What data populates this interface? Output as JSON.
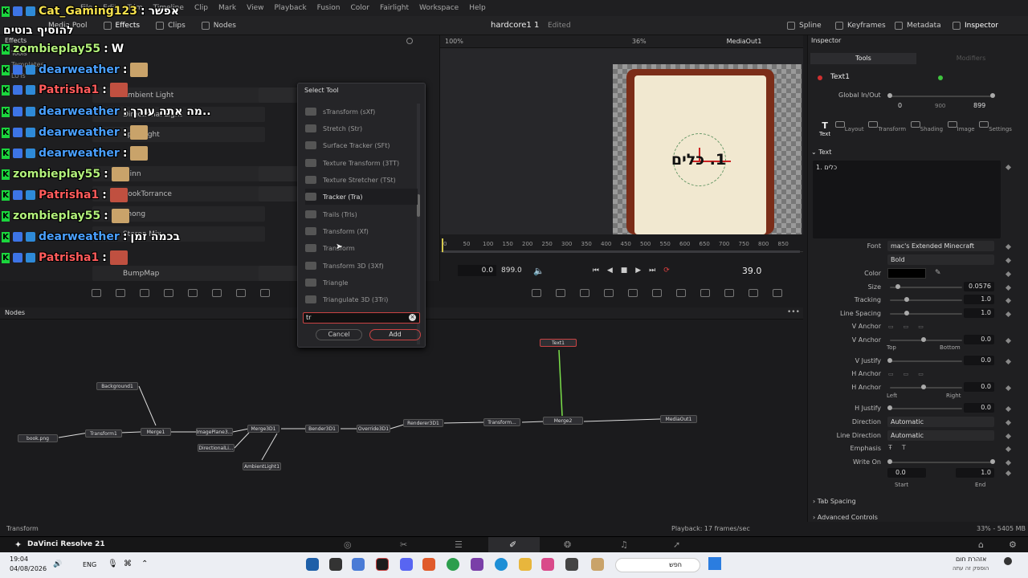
{
  "menu": [
    "Effects",
    "File",
    "Edit",
    "Trim",
    "Timeline",
    "Clip",
    "Mark",
    "View",
    "Playback",
    "Fusion",
    "Color",
    "Fairlight",
    "Workspace",
    "Help"
  ],
  "toolbar": {
    "media_pool": "Media Pool",
    "effects": "Effects",
    "clips": "Clips",
    "nodes": "Nodes",
    "project_title": "hardcore1 1",
    "edited": "Edited",
    "spline": "Spline",
    "keyframes": "Keyframes",
    "metadata": "Metadata",
    "inspector": "Inspector"
  },
  "effects_panel": {
    "header": "Effects",
    "tabs": [
      "Tools",
      "Templates",
      "LUTs"
    ],
    "items": [
      "Ambient Light",
      "Directional Light",
      "Spot Light",
      "Blinn",
      "CookTorrance",
      "Phong",
      "Stereo Mix",
      "BumpMap"
    ],
    "search_icon": "search-icon"
  },
  "viewer": {
    "zoom_left": "100%",
    "zoom_right": "36%",
    "output": "MediaOut1",
    "card_text": "1. כלים",
    "ruler_ticks": [
      "0",
      "50",
      "100",
      "150",
      "200",
      "250",
      "300",
      "350",
      "400",
      "450",
      "500",
      "550",
      "600",
      "650",
      "700",
      "750",
      "800",
      "850"
    ],
    "time_start": "0.0",
    "time_end": "899.0",
    "current_frame": "39.0"
  },
  "dialog": {
    "title": "Select Tool",
    "items": [
      "sTransform (sXf)",
      "Stretch (Str)",
      "Surface Tracker (SFt)",
      "Texture Transform (3TT)",
      "Texture Stretcher (TSt)",
      "Tracker (Tra)",
      "Trails (Trls)",
      "Transform (Xf)",
      "Transform",
      "Transform 3D (3Xf)",
      "Triangle",
      "Triangulate 3D (3Tri)"
    ],
    "selected_index": 5,
    "search_value": "tr",
    "cancel": "Cancel",
    "add": "Add"
  },
  "inspector": {
    "title": "Inspector",
    "tabs": [
      "Tools",
      "Modifiers"
    ],
    "node_name": "Text1",
    "global_label": "Global In/Out",
    "global_in": "0",
    "global_mid": "900",
    "global_out": "899",
    "subtabs": [
      "Text",
      "Layout",
      "Transform",
      "Shading",
      "Image",
      "Settings"
    ],
    "section": "Text",
    "text_value": "1. כלים",
    "font_label": "Font",
    "font_value": "mac's Extended Minecraft",
    "font_style": "Bold",
    "color_label": "Color",
    "color_value": "#000000",
    "size_label": "Size",
    "size_value": "0.0576",
    "tracking_label": "Tracking",
    "tracking_value": "1.0",
    "line_spacing_label": "Line Spacing",
    "line_spacing_value": "1.0",
    "v_anchor_label": "V Anchor",
    "v_anchor2_label": "V Anchor",
    "v_anchor_value": "0.0",
    "top": "Top",
    "bottom": "Bottom",
    "v_justify_label": "V Justify",
    "v_justify_value": "0.0",
    "h_anchor_label": "H Anchor",
    "h_anchor2_label": "H Anchor",
    "h_anchor_value": "0.0",
    "left": "Left",
    "right": "Right",
    "h_justify_label": "H Justify",
    "h_justify_value": "0.0",
    "direction_label": "Direction",
    "direction_value": "Automatic",
    "line_direction_label": "Line Direction",
    "line_direction_value": "Automatic",
    "emphasis_label": "Emphasis",
    "write_on_label": "Write On",
    "write_on_start": "0.0",
    "write_on_end": "1.0",
    "start": "Start",
    "end": "End",
    "tab_spacing": "Tab Spacing",
    "advanced": "Advanced Controls"
  },
  "nodes": {
    "header": "Nodes",
    "list": [
      "Text1",
      "Background1",
      "book.png",
      "Transform1",
      "Merge1",
      "ImagePlane3...",
      "DirectionalLi...",
      "Merge3D1",
      "AmbientLight1",
      "Bender3D1",
      "Override3D1",
      "Renderer3D1",
      "Transform...",
      "Merge2",
      "MediaOut1"
    ]
  },
  "status": {
    "left": "Transform",
    "playback": "Playback: 17 frames/sec",
    "memory": "33% - 5405 MB"
  },
  "resolve": {
    "app": "DaVinci Resolve 21"
  },
  "taskbar": {
    "time": "19:04",
    "date": "04/08/2026",
    "lang": "ENG",
    "search": "חפש",
    "notif_title": "אזהרת חום",
    "notif_body": "הוספק זה עתה"
  },
  "chat": [
    {
      "user": "Cat_Gaming123",
      "msg": "אפשר",
      "color": "#f4e04d",
      "has_thumb": false
    },
    {
      "user": "",
      "msg": "להוסיף בוטים",
      "color": "#fff",
      "has_thumb": false
    },
    {
      "user": "zombieplay55",
      "msg": "W",
      "color": "#b2f07a",
      "has_thumb": false
    },
    {
      "user": "dearweather",
      "msg": "",
      "color": "#4aa0ff",
      "has_thumb": true
    },
    {
      "user": "Patrisha1",
      "msg": "",
      "color": "#ff5b5b",
      "has_thumb": true
    },
    {
      "user": "dearweather",
      "msg": "מה אתה עורך..",
      "color": "#4aa0ff",
      "has_thumb": false
    },
    {
      "user": "dearweather",
      "msg": "",
      "color": "#4aa0ff",
      "has_thumb": true
    },
    {
      "user": "dearweather",
      "msg": "",
      "color": "#4aa0ff",
      "has_thumb": true
    },
    {
      "user": "zombieplay55",
      "msg": "",
      "color": "#b2f07a",
      "has_thumb": true
    },
    {
      "user": "Patrisha1",
      "msg": "",
      "color": "#ff5b5b",
      "has_thumb": true
    },
    {
      "user": "zombieplay55",
      "msg": "",
      "color": "#b2f07a",
      "has_thumb": true
    },
    {
      "user": "dearweather",
      "msg": "בכמה זמן",
      "color": "#4aa0ff",
      "has_thumb": false
    },
    {
      "user": "Patrisha1",
      "msg": "",
      "color": "#ff5b5b",
      "has_thumb": true
    }
  ]
}
